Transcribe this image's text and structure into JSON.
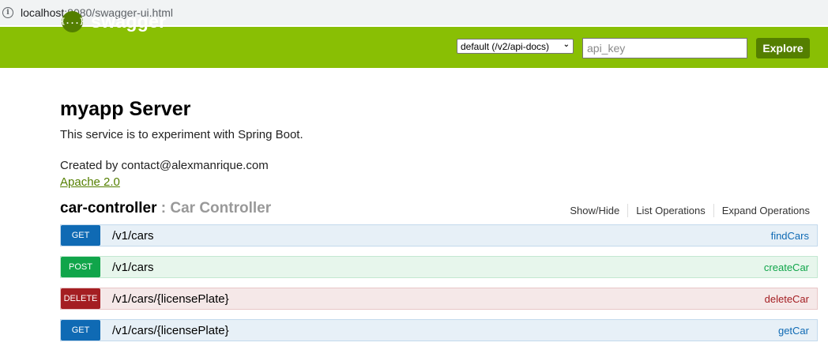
{
  "browser": {
    "url_host": "localhost",
    "url_path": ":8080/swagger-ui.html"
  },
  "header": {
    "logo_icon_text": "{...}",
    "logo_text": "swagger",
    "spec_select_value": "default (/v2/api-docs)",
    "api_key_placeholder": "api_key",
    "explore_label": "Explore"
  },
  "info": {
    "title": "myapp Server",
    "description": "This service is to experiment with Spring Boot.",
    "created_by": "Created by contact@alexmanrique.com",
    "license": "Apache 2.0"
  },
  "resource": {
    "name": "car-controller",
    "separator": " : ",
    "description": "Car Controller",
    "links": [
      "Show/Hide",
      "List Operations",
      "Expand Operations"
    ]
  },
  "operations": [
    {
      "method": "GET",
      "path": "/v1/cars",
      "nickname": "findCars"
    },
    {
      "method": "POST",
      "path": "/v1/cars",
      "nickname": "createCar"
    },
    {
      "method": "DELETE",
      "path": "/v1/cars/{licensePlate}",
      "nickname": "deleteCar"
    },
    {
      "method": "GET",
      "path": "/v1/cars/{licensePlate}",
      "nickname": "getCar"
    }
  ],
  "colors": {
    "header_bg": "#89bf04",
    "accent_dark": "#547f00",
    "get": "#0f6ab4",
    "post": "#10a54a",
    "delete": "#a41e22"
  }
}
